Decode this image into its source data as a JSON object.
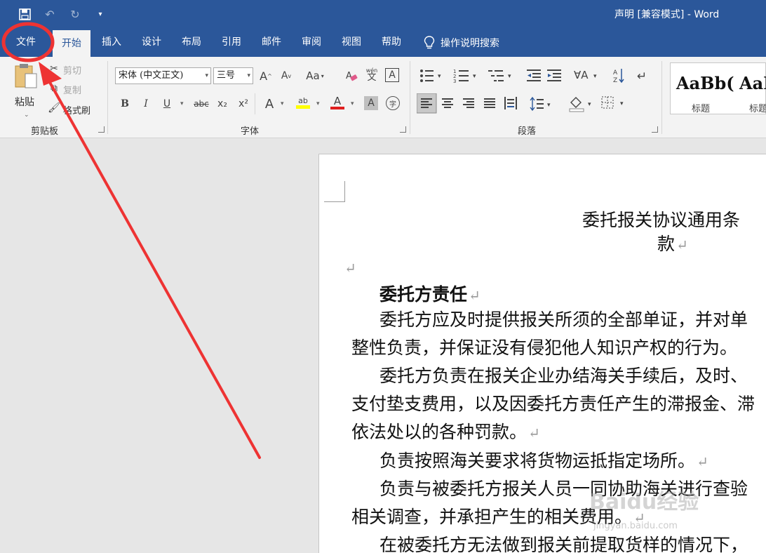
{
  "title_bar": {
    "doc_title": "声明 [兼容模式]  -  Word"
  },
  "tabs": [
    {
      "label": "文件"
    },
    {
      "label": "开始"
    },
    {
      "label": "插入"
    },
    {
      "label": "设计"
    },
    {
      "label": "布局"
    },
    {
      "label": "引用"
    },
    {
      "label": "邮件"
    },
    {
      "label": "审阅"
    },
    {
      "label": "视图"
    },
    {
      "label": "帮助"
    }
  ],
  "tell_me": {
    "label": "操作说明搜索"
  },
  "clipboard": {
    "paste": "粘贴",
    "cut": "剪切",
    "copy": "复制",
    "format_painter": "格式刷",
    "group": "剪贴板"
  },
  "font": {
    "name": "宋体 (中文正文)",
    "size": "三号",
    "group": "字体",
    "bold": "B",
    "italic": "I",
    "underline": "U",
    "strike": "abc",
    "sub": "x₂",
    "sup": "x²",
    "grow": "A",
    "shrink": "A",
    "case": "Aa",
    "phonetic_top": "wén",
    "phonetic_bottom": "文",
    "border": "A",
    "effects": "A",
    "highlight": "ab",
    "color": "A",
    "shading": "A",
    "enclose": "字"
  },
  "paragraph": {
    "group": "段落"
  },
  "styles": [
    {
      "sample": "AaBb(",
      "name": "标题"
    },
    {
      "sample": "AaE",
      "name": "标题"
    }
  ],
  "document": {
    "title_line1": "委托报关协议通用条",
    "title_line2": "款",
    "heading": "委托方责任",
    "lines": [
      "委托方应及时提供报关所须的全部单证，并对单",
      "整性负责，并保证没有侵犯他人知识产权的行为。",
      "委托方负责在报关企业办结海关手续后，及时、",
      "支付垫支费用，以及因委托方责任产生的滞报金、滞",
      "依法处以的各种罚款。",
      "负责按照海关要求将货物运抵指定场所。",
      "负责与被委托方报关人员一同协助海关进行查验",
      "相关调查，并承担产生的相关费用。",
      "在被委托方无法做到报关前提取货样的情况下，"
    ],
    "pilcrow": "↵"
  },
  "watermark": {
    "main": "Baidu经验",
    "sub": "jingyan.baidu.com"
  },
  "annotation": {
    "color": "#ee3333"
  }
}
